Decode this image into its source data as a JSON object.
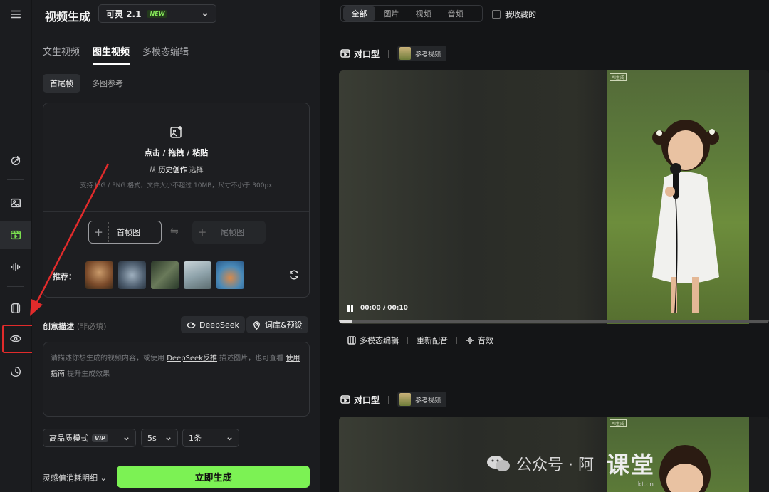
{
  "header": {
    "title": "视频生成",
    "model": "可灵 2.1",
    "model_badge": "NEW"
  },
  "mode_tabs": [
    "文生视频",
    "图生视频",
    "多模态编辑"
  ],
  "sub_tabs": [
    "首尾帧",
    "多图参考"
  ],
  "upload": {
    "title": "点击 / 拖拽 / 粘贴",
    "history_prefix": "从",
    "history_link": "历史创作",
    "history_suffix": "选择",
    "hint": "支持 JPG / PNG 格式，文件大小不超过 10MB，尺寸不小于 300px",
    "first_frame": "首帧图",
    "last_frame": "尾帧图",
    "recommend_label": "推荐："
  },
  "description": {
    "label": "创意描述",
    "optional": "(非必填)",
    "deepseek_button": "DeepSeek",
    "library_button": "词库&预设",
    "placeholder_1": "请描述你想生成的视频内容，或使用",
    "placeholder_link_1": "DeepSeek反推",
    "placeholder_2": "描述图片，也可查看",
    "placeholder_link_2": "使用指南",
    "placeholder_3": "提升生成效果"
  },
  "options": {
    "quality": "高品质模式",
    "quality_badge": "VIP",
    "duration": "5s",
    "count": "1条"
  },
  "footer": {
    "cost_detail": "灵感值消耗明细",
    "generate_button": "立即生成"
  },
  "right": {
    "filters": [
      "全部",
      "图片",
      "视频",
      "音频"
    ],
    "favorites": "我收藏的",
    "card_title": "对口型",
    "ref_video": "参考视频",
    "time": "00:00 / 00:10",
    "video_watermark": "AI生成",
    "playback_progress_pct": 3,
    "actions": [
      "多模态编辑",
      "重新配音",
      "音效"
    ]
  },
  "watermark": {
    "text": "公众号 · 阿",
    "brand": "课堂",
    "site": "kt.cn"
  },
  "colors": {
    "accent": "#7cf254",
    "highlight_box": "#e12b2b"
  }
}
